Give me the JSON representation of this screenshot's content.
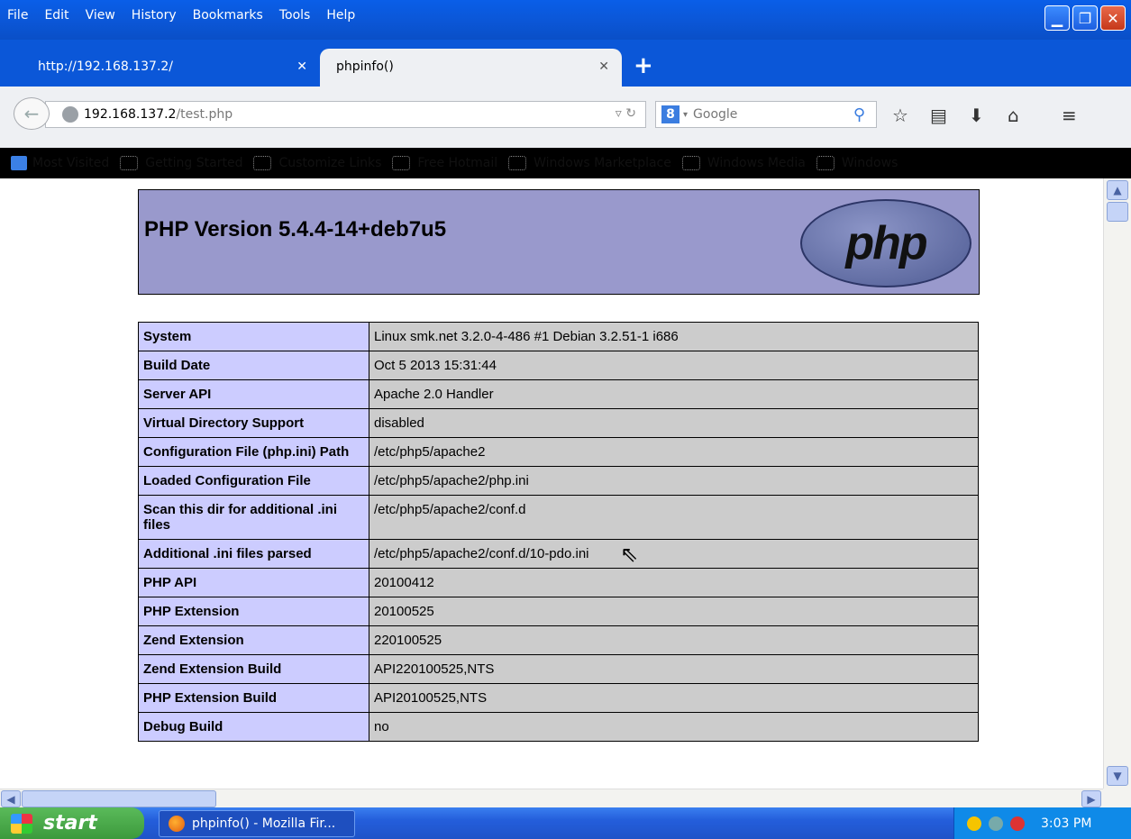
{
  "menu": [
    "File",
    "Edit",
    "View",
    "History",
    "Bookmarks",
    "Tools",
    "Help"
  ],
  "tabs": [
    {
      "label": "http://192.168.137.2/",
      "close": "✕"
    },
    {
      "label": "phpinfo()",
      "close": "✕"
    }
  ],
  "newtab": "+",
  "url": {
    "host": "192.168.137.2",
    "path": "/test.php"
  },
  "search": {
    "engine": "8",
    "placeholder": "Google"
  },
  "bookmarks": [
    "Most Visited",
    "Getting Started",
    "Customize Links",
    "Free Hotmail",
    "Windows Marketplace",
    "Windows Media",
    "Windows"
  ],
  "page": {
    "title": "PHP Version 5.4.4-14+deb7u5",
    "logo": "php",
    "rows": [
      [
        "System",
        "Linux smk.net 3.2.0-4-486 #1 Debian 3.2.51-1 i686"
      ],
      [
        "Build Date",
        "Oct 5 2013 15:31:44"
      ],
      [
        "Server API",
        "Apache 2.0 Handler"
      ],
      [
        "Virtual Directory Support",
        "disabled"
      ],
      [
        "Configuration File (php.ini) Path",
        "/etc/php5/apache2"
      ],
      [
        "Loaded Configuration File",
        "/etc/php5/apache2/php.ini"
      ],
      [
        "Scan this dir for additional .ini files",
        "/etc/php5/apache2/conf.d"
      ],
      [
        "Additional .ini files parsed",
        "/etc/php5/apache2/conf.d/10-pdo.ini"
      ],
      [
        "PHP API",
        "20100412"
      ],
      [
        "PHP Extension",
        "20100525"
      ],
      [
        "Zend Extension",
        "220100525"
      ],
      [
        "Zend Extension Build",
        "API220100525,NTS"
      ],
      [
        "PHP Extension Build",
        "API20100525,NTS"
      ],
      [
        "Debug Build",
        "no"
      ]
    ]
  },
  "taskbar": {
    "start": "start",
    "item": "phpinfo() - Mozilla Fir...",
    "clock": "3:03 PM"
  }
}
